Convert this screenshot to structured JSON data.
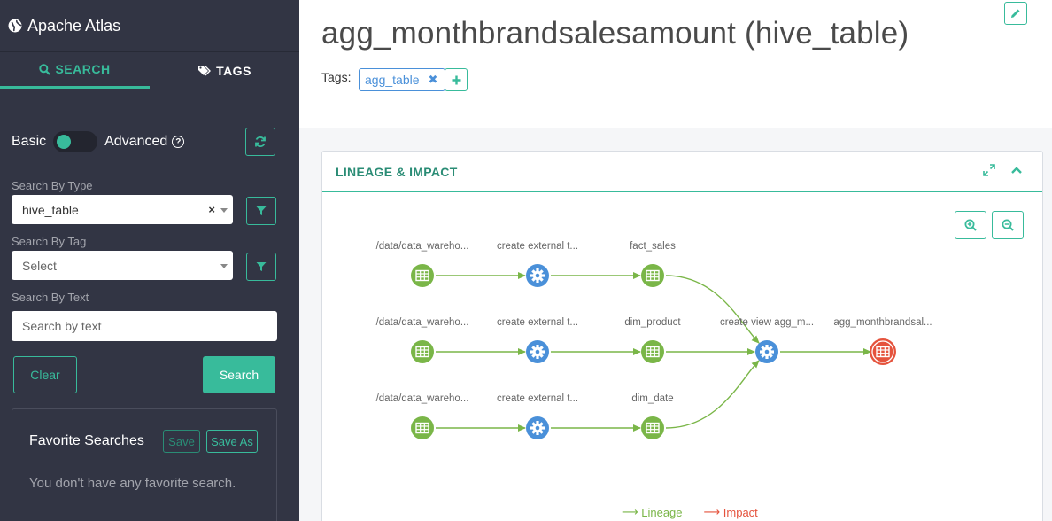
{
  "app": {
    "title": "Apache Atlas"
  },
  "tabs": [
    {
      "label": "SEARCH"
    },
    {
      "label": "TAGS"
    }
  ],
  "search": {
    "basic_label": "Basic",
    "advanced_label": "Advanced",
    "mode": "basic",
    "by_type_label": "Search By Type",
    "type_value": "hive_table",
    "by_tag_label": "Search By Tag",
    "tag_placeholder": "Select",
    "by_text_label": "Search By Text",
    "text_placeholder": "Search by text",
    "clear_label": "Clear",
    "search_label": "Search"
  },
  "favorites": {
    "title": "Favorite Searches",
    "save_label": "Save",
    "save_as_label": "Save As",
    "empty_text": "You don't have any favorite search."
  },
  "entity": {
    "title": "agg_monthbrandsalesamount (hive_table)",
    "tags_label": "Tags:",
    "tags": [
      "agg_table"
    ]
  },
  "lineage": {
    "title": "LINEAGE & IMPACT",
    "nodes": [
      {
        "id": "n1",
        "label": "/data/data_wareho...",
        "kind": "dataset"
      },
      {
        "id": "n2",
        "label": "create external t...",
        "kind": "process"
      },
      {
        "id": "n3",
        "label": "fact_sales",
        "kind": "dataset"
      },
      {
        "id": "n4",
        "label": "/data/data_wareho...",
        "kind": "dataset"
      },
      {
        "id": "n5",
        "label": "create external t...",
        "kind": "process"
      },
      {
        "id": "n6",
        "label": "dim_product",
        "kind": "dataset"
      },
      {
        "id": "n7",
        "label": "/data/data_wareho...",
        "kind": "dataset"
      },
      {
        "id": "n8",
        "label": "create external t...",
        "kind": "process"
      },
      {
        "id": "n9",
        "label": "dim_date",
        "kind": "dataset"
      },
      {
        "id": "n10",
        "label": "create view agg_m...",
        "kind": "process"
      },
      {
        "id": "n11",
        "label": "agg_monthbrandsal...",
        "kind": "current"
      }
    ],
    "legend": {
      "lineage": "Lineage",
      "impact": "Impact"
    },
    "colors": {
      "lineage": "#7ab648",
      "impact": "#e5533d",
      "process": "#4a90d9",
      "accent": "#38bb9b"
    }
  }
}
